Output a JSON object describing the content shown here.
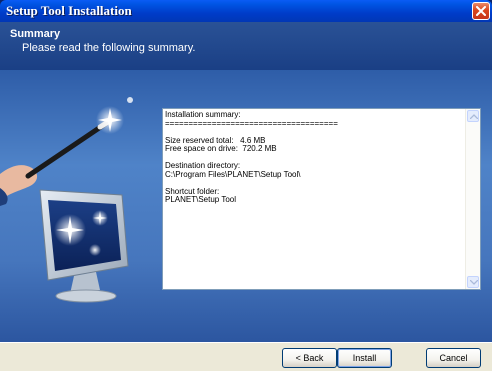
{
  "window": {
    "title": "Setup Tool Installation"
  },
  "header": {
    "title": "Summary",
    "subtitle": "Please read the following summary."
  },
  "summary": {
    "lines": [
      "Installation summary:",
      "=====================================",
      "",
      "Size reserved total:   4.6 MB",
      "Free space on drive:  720.2 MB",
      "",
      "Destination directory:",
      "C:\\Program Files\\PLANET\\Setup Tool\\",
      "",
      "Shortcut folder:",
      "PLANET\\Setup Tool"
    ]
  },
  "buttons": {
    "back": {
      "label": "< Back",
      "mnemonic": "B"
    },
    "install": {
      "label": "Install",
      "mnemonic": "I"
    },
    "cancel": {
      "label": "Cancel",
      "mnemonic": "C"
    }
  },
  "icons": {
    "close": "close-icon",
    "art": "wizard-wand-monitor-illustration",
    "scroll_up": "scroll-up-arrow-icon",
    "scroll_down": "scroll-down-arrow-icon"
  },
  "colors": {
    "titlebar": "#0054e3",
    "header": "#1f4a8f",
    "body": "#4a7cc4",
    "footer": "#ece9d8",
    "close": "#d8451c"
  }
}
